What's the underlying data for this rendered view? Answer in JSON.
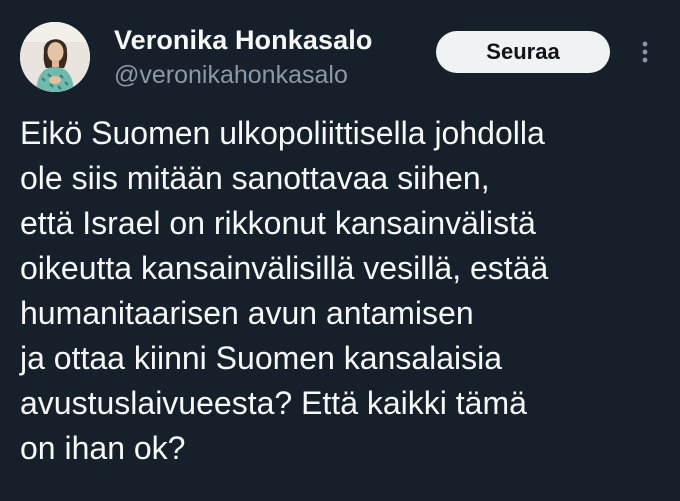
{
  "tweet": {
    "author": {
      "display_name": "Veronika Honkasalo",
      "handle": "@veronikahonkasalo"
    },
    "follow_label": "Seuraa",
    "more_icon": "more-vertical-icon",
    "text_lines": [
      "Eikö Suomen ulkopoliittisella johdolla",
      "ole siis mitään sanottavaa siihen,",
      "että Israel on rikkonut kansainvälistä",
      "oikeutta kansainvälisillä vesillä, estää",
      "humanitaarisen avun antamisen",
      "ja ottaa kiinni Suomen kansalaisia",
      "avustuslaivueesta? Että kaikki tämä",
      "on ihan ok?"
    ]
  },
  "colors": {
    "background": "#15202b",
    "text_primary": "#f7f9f9",
    "text_secondary": "#8b98a5",
    "follow_button_bg": "#eff3f4",
    "follow_button_text": "#0f1419"
  }
}
